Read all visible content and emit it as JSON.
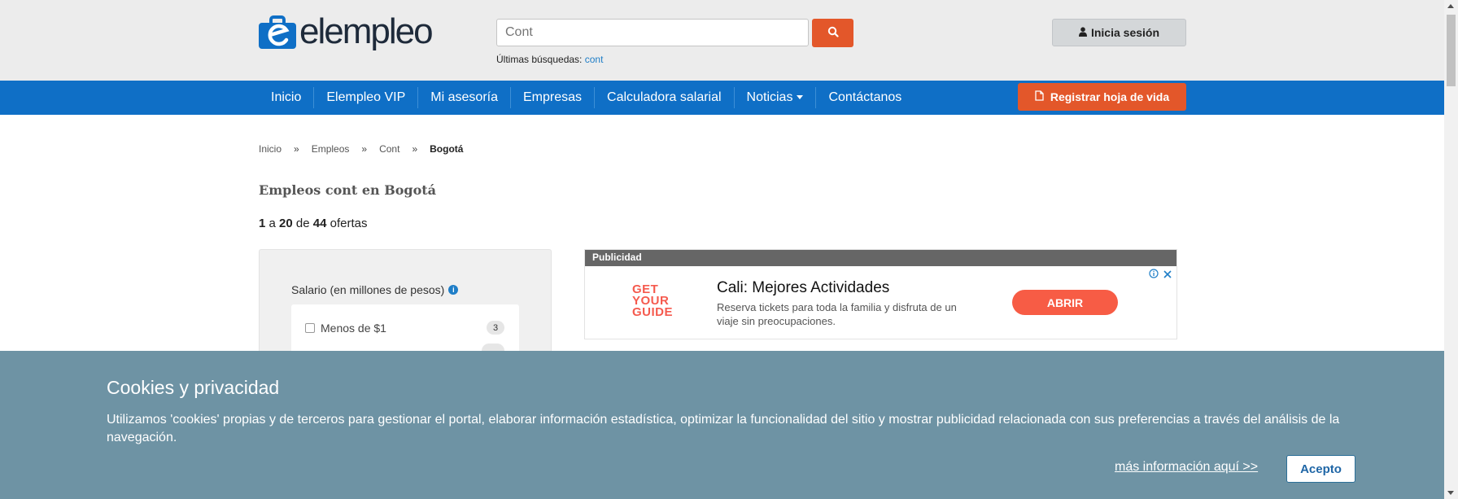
{
  "header": {
    "logo_text": "elempleo",
    "search": {
      "value": "",
      "placeholder": "Cont"
    },
    "recent_label": "Últimas búsquedas:",
    "recent_link": "cont",
    "login_label": "Inicia sesión"
  },
  "nav": {
    "items": [
      {
        "label": "Inicio"
      },
      {
        "label": "Elempleo VIP"
      },
      {
        "label": "Mi asesoría"
      },
      {
        "label": "Empresas"
      },
      {
        "label": "Calculadora salarial"
      },
      {
        "label": "Noticias"
      },
      {
        "label": "Contáctanos"
      }
    ],
    "register_label": "Registrar hoja de vida"
  },
  "breadcrumb": {
    "items": [
      "Inicio",
      "Empleos",
      "Cont"
    ],
    "current": "Bogotá",
    "separator": "»"
  },
  "main": {
    "title": "Empleos cont en Bogotá",
    "results": {
      "from": "1",
      "to": "20",
      "total": "44",
      "a": "a",
      "de": "de",
      "suffix": "ofertas"
    }
  },
  "filters": {
    "salary_title": "Salario (en millones de pesos)",
    "options": [
      {
        "label": "Menos de $1",
        "count": "3"
      }
    ]
  },
  "ad": {
    "label": "Publicidad",
    "brand_lines": [
      "GET",
      "YOUR",
      "GUIDE"
    ],
    "headline": "Cali: Mejores Actividades",
    "description": "Reserva tickets para toda la familia y disfruta de un viaje sin preocupaciones.",
    "cta": "ABRIR"
  },
  "cookie": {
    "title": "Cookies y privacidad",
    "text": "Utilizamos 'cookies' propias y de terceros para gestionar el portal, elaborar información estadística, optimizar la funcionalidad del sitio y mostrar publicidad relacionada con sus preferencias a través del análisis de la navegación.",
    "more_link": "más información aquí >>",
    "accept": "Acepto"
  },
  "colors": {
    "nav_blue": "#0f6fc6",
    "accent_orange": "#e3572a",
    "cookie_bg": "#6e93a4"
  }
}
